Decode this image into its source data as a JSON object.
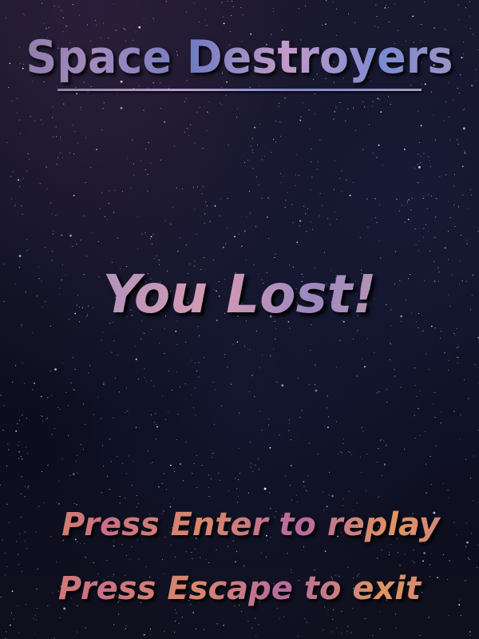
{
  "game": {
    "title": "Space Destroyers",
    "result": "You Lost!",
    "prompts": {
      "replay": "Press Enter to replay",
      "exit": "Press Escape to exit"
    }
  },
  "colors": {
    "background": "#0c0e1f",
    "title_tint": "#a38bbd",
    "result_tint": "#b995bb",
    "prompt_tint": "#e08a5a"
  }
}
